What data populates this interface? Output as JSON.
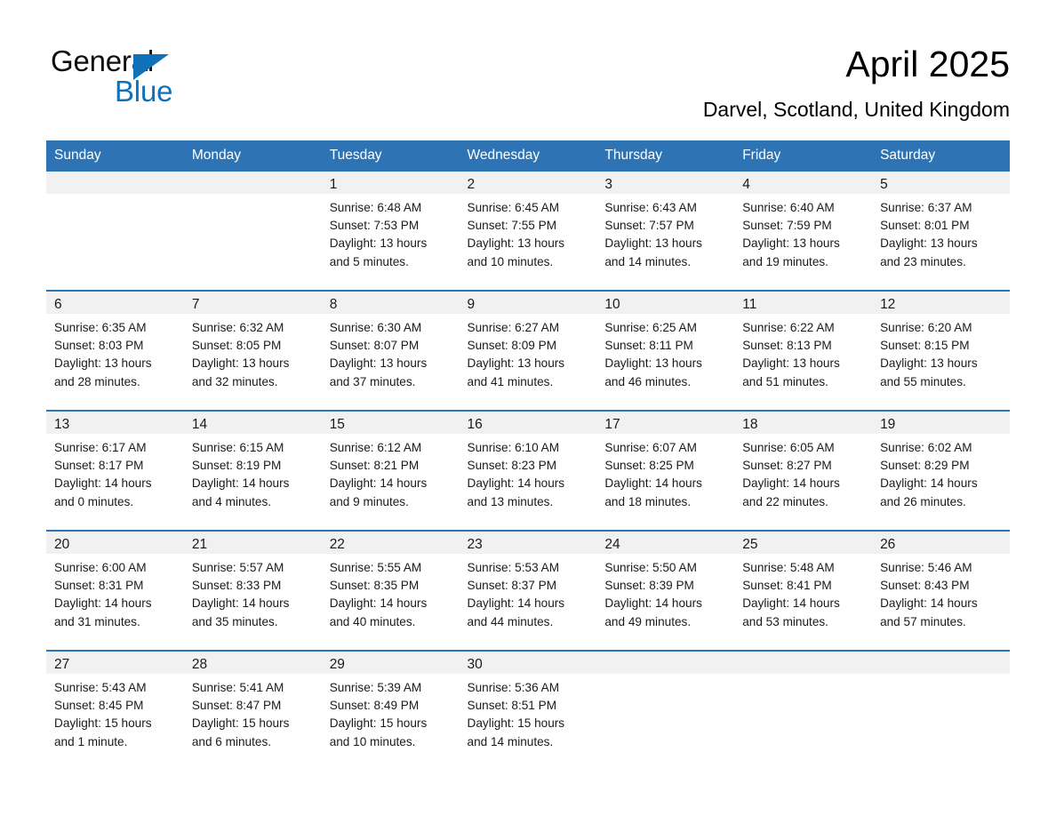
{
  "brand": {
    "name_part1": "General",
    "name_part2": "Blue",
    "triangle_icon": "triangle-icon",
    "accent_color": "#1071b8"
  },
  "header": {
    "month_title": "April 2025",
    "location": "Darvel, Scotland, United Kingdom"
  },
  "colors": {
    "header_blue": "#2e74b5",
    "row_divider_blue": "#2e74b5",
    "daynum_band_gray": "#f1f1f1",
    "text": "#1a1a1a",
    "page_background": "#ffffff"
  },
  "calendar": {
    "weekday_headers": [
      "Sunday",
      "Monday",
      "Tuesday",
      "Wednesday",
      "Thursday",
      "Friday",
      "Saturday"
    ],
    "weeks": [
      [
        {
          "day": "",
          "empty": true
        },
        {
          "day": "",
          "empty": true
        },
        {
          "day": "1",
          "sunrise": "Sunrise: 6:48 AM",
          "sunset": "Sunset: 7:53 PM",
          "daylight": "Daylight: 13 hours and 5 minutes."
        },
        {
          "day": "2",
          "sunrise": "Sunrise: 6:45 AM",
          "sunset": "Sunset: 7:55 PM",
          "daylight": "Daylight: 13 hours and 10 minutes."
        },
        {
          "day": "3",
          "sunrise": "Sunrise: 6:43 AM",
          "sunset": "Sunset: 7:57 PM",
          "daylight": "Daylight: 13 hours and 14 minutes."
        },
        {
          "day": "4",
          "sunrise": "Sunrise: 6:40 AM",
          "sunset": "Sunset: 7:59 PM",
          "daylight": "Daylight: 13 hours and 19 minutes."
        },
        {
          "day": "5",
          "sunrise": "Sunrise: 6:37 AM",
          "sunset": "Sunset: 8:01 PM",
          "daylight": "Daylight: 13 hours and 23 minutes."
        }
      ],
      [
        {
          "day": "6",
          "sunrise": "Sunrise: 6:35 AM",
          "sunset": "Sunset: 8:03 PM",
          "daylight": "Daylight: 13 hours and 28 minutes."
        },
        {
          "day": "7",
          "sunrise": "Sunrise: 6:32 AM",
          "sunset": "Sunset: 8:05 PM",
          "daylight": "Daylight: 13 hours and 32 minutes."
        },
        {
          "day": "8",
          "sunrise": "Sunrise: 6:30 AM",
          "sunset": "Sunset: 8:07 PM",
          "daylight": "Daylight: 13 hours and 37 minutes."
        },
        {
          "day": "9",
          "sunrise": "Sunrise: 6:27 AM",
          "sunset": "Sunset: 8:09 PM",
          "daylight": "Daylight: 13 hours and 41 minutes."
        },
        {
          "day": "10",
          "sunrise": "Sunrise: 6:25 AM",
          "sunset": "Sunset: 8:11 PM",
          "daylight": "Daylight: 13 hours and 46 minutes."
        },
        {
          "day": "11",
          "sunrise": "Sunrise: 6:22 AM",
          "sunset": "Sunset: 8:13 PM",
          "daylight": "Daylight: 13 hours and 51 minutes."
        },
        {
          "day": "12",
          "sunrise": "Sunrise: 6:20 AM",
          "sunset": "Sunset: 8:15 PM",
          "daylight": "Daylight: 13 hours and 55 minutes."
        }
      ],
      [
        {
          "day": "13",
          "sunrise": "Sunrise: 6:17 AM",
          "sunset": "Sunset: 8:17 PM",
          "daylight": "Daylight: 14 hours and 0 minutes."
        },
        {
          "day": "14",
          "sunrise": "Sunrise: 6:15 AM",
          "sunset": "Sunset: 8:19 PM",
          "daylight": "Daylight: 14 hours and 4 minutes."
        },
        {
          "day": "15",
          "sunrise": "Sunrise: 6:12 AM",
          "sunset": "Sunset: 8:21 PM",
          "daylight": "Daylight: 14 hours and 9 minutes."
        },
        {
          "day": "16",
          "sunrise": "Sunrise: 6:10 AM",
          "sunset": "Sunset: 8:23 PM",
          "daylight": "Daylight: 14 hours and 13 minutes."
        },
        {
          "day": "17",
          "sunrise": "Sunrise: 6:07 AM",
          "sunset": "Sunset: 8:25 PM",
          "daylight": "Daylight: 14 hours and 18 minutes."
        },
        {
          "day": "18",
          "sunrise": "Sunrise: 6:05 AM",
          "sunset": "Sunset: 8:27 PM",
          "daylight": "Daylight: 14 hours and 22 minutes."
        },
        {
          "day": "19",
          "sunrise": "Sunrise: 6:02 AM",
          "sunset": "Sunset: 8:29 PM",
          "daylight": "Daylight: 14 hours and 26 minutes."
        }
      ],
      [
        {
          "day": "20",
          "sunrise": "Sunrise: 6:00 AM",
          "sunset": "Sunset: 8:31 PM",
          "daylight": "Daylight: 14 hours and 31 minutes."
        },
        {
          "day": "21",
          "sunrise": "Sunrise: 5:57 AM",
          "sunset": "Sunset: 8:33 PM",
          "daylight": "Daylight: 14 hours and 35 minutes."
        },
        {
          "day": "22",
          "sunrise": "Sunrise: 5:55 AM",
          "sunset": "Sunset: 8:35 PM",
          "daylight": "Daylight: 14 hours and 40 minutes."
        },
        {
          "day": "23",
          "sunrise": "Sunrise: 5:53 AM",
          "sunset": "Sunset: 8:37 PM",
          "daylight": "Daylight: 14 hours and 44 minutes."
        },
        {
          "day": "24",
          "sunrise": "Sunrise: 5:50 AM",
          "sunset": "Sunset: 8:39 PM",
          "daylight": "Daylight: 14 hours and 49 minutes."
        },
        {
          "day": "25",
          "sunrise": "Sunrise: 5:48 AM",
          "sunset": "Sunset: 8:41 PM",
          "daylight": "Daylight: 14 hours and 53 minutes."
        },
        {
          "day": "26",
          "sunrise": "Sunrise: 5:46 AM",
          "sunset": "Sunset: 8:43 PM",
          "daylight": "Daylight: 14 hours and 57 minutes."
        }
      ],
      [
        {
          "day": "27",
          "sunrise": "Sunrise: 5:43 AM",
          "sunset": "Sunset: 8:45 PM",
          "daylight": "Daylight: 15 hours and 1 minute."
        },
        {
          "day": "28",
          "sunrise": "Sunrise: 5:41 AM",
          "sunset": "Sunset: 8:47 PM",
          "daylight": "Daylight: 15 hours and 6 minutes."
        },
        {
          "day": "29",
          "sunrise": "Sunrise: 5:39 AM",
          "sunset": "Sunset: 8:49 PM",
          "daylight": "Daylight: 15 hours and 10 minutes."
        },
        {
          "day": "30",
          "sunrise": "Sunrise: 5:36 AM",
          "sunset": "Sunset: 8:51 PM",
          "daylight": "Daylight: 15 hours and 14 minutes."
        },
        {
          "day": "",
          "empty": true
        },
        {
          "day": "",
          "empty": true
        },
        {
          "day": "",
          "empty": true
        }
      ]
    ]
  }
}
